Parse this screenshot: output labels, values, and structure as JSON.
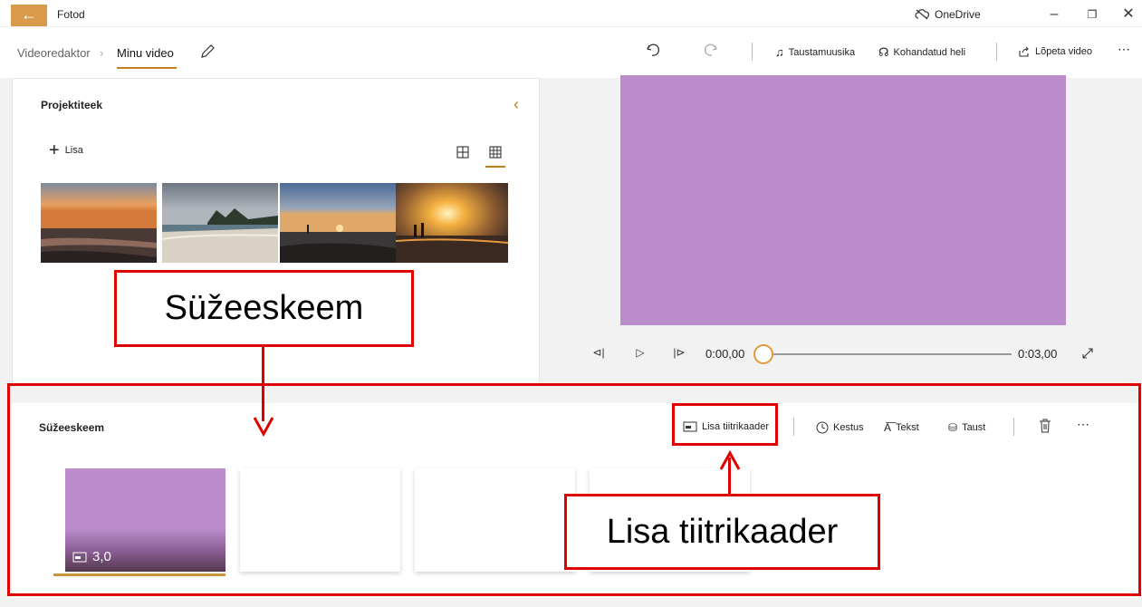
{
  "titlebar": {
    "app_name": "Fotod",
    "onedrive_label": "OneDrive"
  },
  "breadcrumb": {
    "parent": "Videoredaktor",
    "current": "Minu video"
  },
  "toolbar": {
    "music_label": "Taustamuusika",
    "custom_audio_label": "Kohandatud heli",
    "finish_label": "Lõpeta video"
  },
  "library": {
    "title": "Projektiteek",
    "add_label": "Lisa",
    "thumbnails": [
      "sunset-sea",
      "cloudy-beach",
      "beach-dusk",
      "sun-over-sea"
    ]
  },
  "preview": {
    "current_time": "0:00,00",
    "end_time": "0:03,00",
    "progress": 0,
    "color": "#bb8dcd"
  },
  "storyboard": {
    "title": "Süžeeskeem",
    "add_title_card_label": "Lisa tiitrikaader",
    "duration_label": "Kestus",
    "text_label": "Tekst",
    "background_label": "Taust",
    "cards": [
      {
        "type": "title",
        "duration": "3,0",
        "color": "#bb8dcd"
      },
      {
        "type": "empty"
      },
      {
        "type": "empty"
      },
      {
        "type": "empty"
      }
    ]
  },
  "annotations": {
    "storyboard_callout": "Süžeeskeem",
    "title_card_callout": "Lisa tiitrikaader",
    "highlight_color": "#e00000"
  },
  "colors": {
    "accent": "#c47d1c",
    "back_button": "#d99a4a"
  }
}
